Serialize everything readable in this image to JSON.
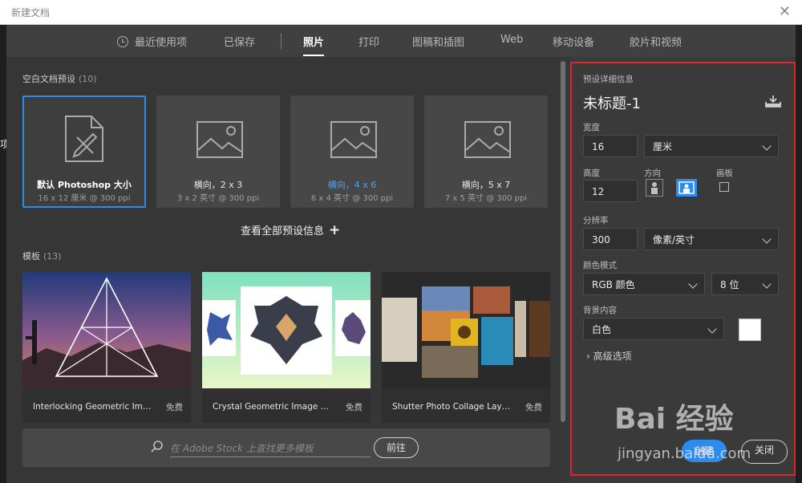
{
  "window": {
    "title": "新建文档",
    "close_icon": "close-icon"
  },
  "left_strip_char": "项",
  "tabs": [
    {
      "label": "最近使用项"
    },
    {
      "label": "已保存"
    },
    {
      "label": "照片"
    },
    {
      "label": "打印"
    },
    {
      "label": "图稿和插图"
    },
    {
      "label": "Web"
    },
    {
      "label": "移动设备"
    },
    {
      "label": "胶片和视频"
    }
  ],
  "blank_presets": {
    "heading": "空白文档预设",
    "count": "(10)",
    "items": [
      {
        "name": "默认 Photoshop 大小",
        "sub": "16 x 12 厘米 @ 300 ppi"
      },
      {
        "name": "横向，2 x 3",
        "sub": "3 x 2 英寸 @ 300 ppi"
      },
      {
        "name": "横向，4 x 6",
        "sub": "6 x 4 英寸 @ 300 ppi"
      },
      {
        "name": "横向，5 x 7",
        "sub": "7 x 5 英寸 @ 300 ppi"
      }
    ],
    "view_all": "查看全部预设信息",
    "view_all_plus": "+"
  },
  "templates": {
    "heading": "模板",
    "count": "(13)",
    "items": [
      {
        "name": "Interlocking Geometric Image M...",
        "price": "免费"
      },
      {
        "name": "Crystal Geometric Image Masks",
        "price": "免费"
      },
      {
        "name": "Shutter Photo Collage Layouts",
        "price": "免费"
      }
    ]
  },
  "stock": {
    "placeholder": "在 Adobe Stock 上查找更多模板",
    "go": "前往"
  },
  "details": {
    "heading": "预设详细信息",
    "doc_title": "未标题-1",
    "width_label": "宽度",
    "width_value": "16",
    "unit": "厘米",
    "height_label": "高度",
    "height_value": "12",
    "orientation_label": "方向",
    "artboard_label": "画板",
    "resolution_label": "分辨率",
    "resolution_value": "300",
    "resolution_unit": "像素/英寸",
    "color_mode_label": "颜色模式",
    "color_mode": "RGB 颜色",
    "bit_depth": "8 位",
    "background_label": "背景内容",
    "background": "白色",
    "advanced": "高级选项",
    "create": "创建",
    "close": "关闭"
  },
  "watermark": {
    "brand": "Bai 经验",
    "url": "jingyan.baidu.com"
  },
  "colors": {
    "accent": "#2d8ceb",
    "highlight_box": "#e3232b"
  }
}
